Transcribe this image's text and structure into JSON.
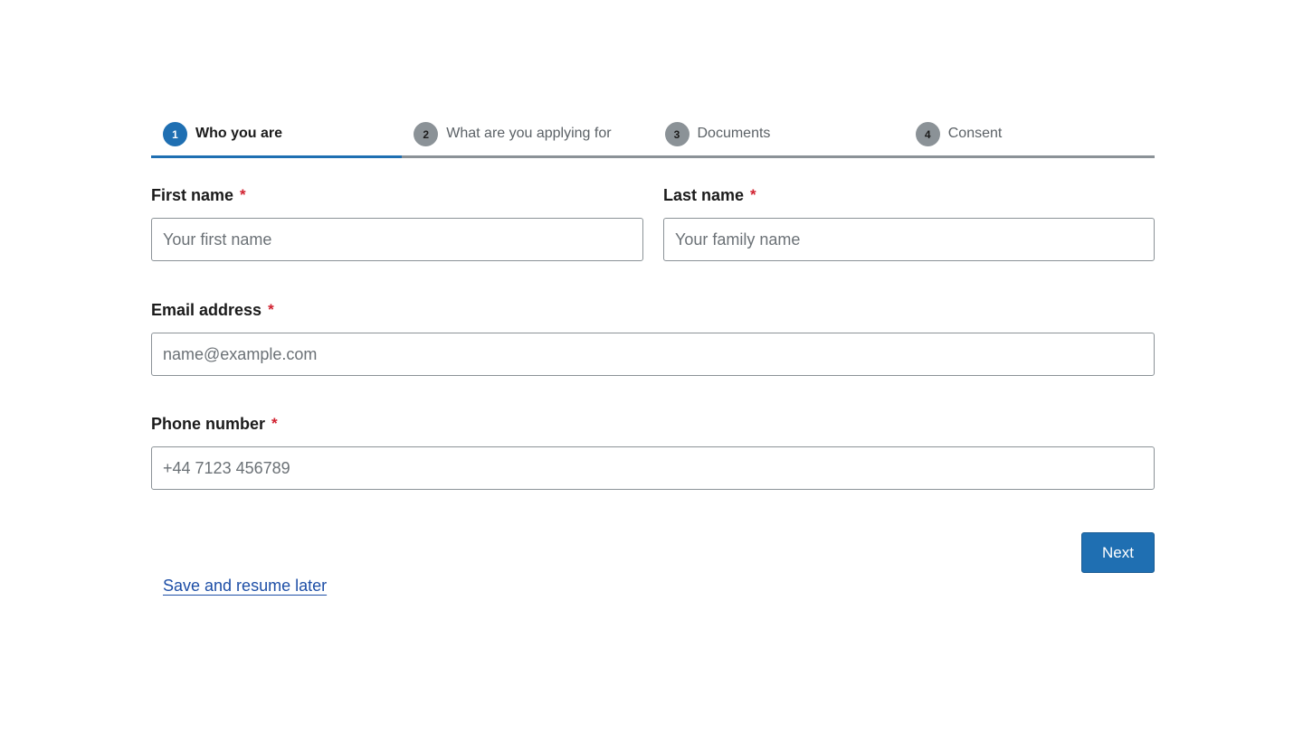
{
  "stepper": {
    "steps": [
      {
        "number": "1",
        "label": "Who you are",
        "state": "active"
      },
      {
        "number": "2",
        "label": "What are you applying for",
        "state": "inactive"
      },
      {
        "number": "3",
        "label": "Documents",
        "state": "inactive"
      },
      {
        "number": "4",
        "label": "Consent",
        "state": "inactive"
      }
    ]
  },
  "form": {
    "first_name": {
      "label": "First name",
      "required_mark": "*",
      "placeholder": "Your first name",
      "value": ""
    },
    "last_name": {
      "label": "Last name",
      "required_mark": "*",
      "placeholder": "Your family name",
      "value": ""
    },
    "email": {
      "label": "Email address",
      "required_mark": "*",
      "placeholder": "name@example.com",
      "value": ""
    },
    "phone": {
      "label": "Phone number",
      "required_mark": "*",
      "placeholder": "+44 7123 456789",
      "value": ""
    }
  },
  "actions": {
    "next_label": "Next",
    "save_link_label": "Save and resume later"
  },
  "colors": {
    "accent": "#1f6fb2",
    "inactive_step": "#8b9297",
    "required": "#d1212f",
    "link": "#1d4ea6"
  }
}
